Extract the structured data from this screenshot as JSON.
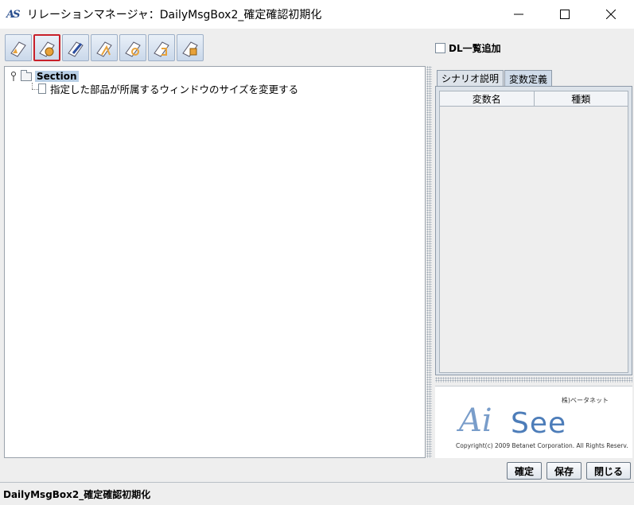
{
  "window": {
    "title": "リレーションマネージャ：DailyMsgBox2_確定確認初期化",
    "controls": [
      "minimize-icon",
      "maximize-icon",
      "close-icon"
    ]
  },
  "toolbar": {
    "buttons": [
      {
        "icon": "edit-icon"
      },
      {
        "icon": "settings-icon",
        "active": true
      },
      {
        "icon": "pen-icon"
      },
      {
        "icon": "cut-icon"
      },
      {
        "icon": "refresh-icon"
      },
      {
        "icon": "export-icon"
      },
      {
        "icon": "import-icon"
      }
    ]
  },
  "dl_checkbox": {
    "label": "DL一覧追加",
    "checked": false
  },
  "tree": {
    "root_label": "Section",
    "children": [
      "指定した部品が所属するウィンドウのサイズを変更する"
    ]
  },
  "tabs": [
    {
      "label": "シナリオ説明",
      "selected": false
    },
    {
      "label": "変数定義",
      "selected": true
    }
  ],
  "variables_table": {
    "columns": [
      "変数名",
      "種類"
    ],
    "rows": []
  },
  "logo": {
    "company": "株)ベータネット",
    "brand_ai": "Ai",
    "brand_see": "See",
    "copyright": "Copyright(c) 2009 Betanet Corporation. All Rights Reserv."
  },
  "buttons": {
    "confirm": "確定",
    "save": "保存",
    "close": "閉じる"
  },
  "status": {
    "text": "DailyMsgBox2_確定確認初期化"
  },
  "colors": {
    "accent": "#4d7db9",
    "active_border": "#c8202a",
    "selection": "#b8cfe5"
  }
}
